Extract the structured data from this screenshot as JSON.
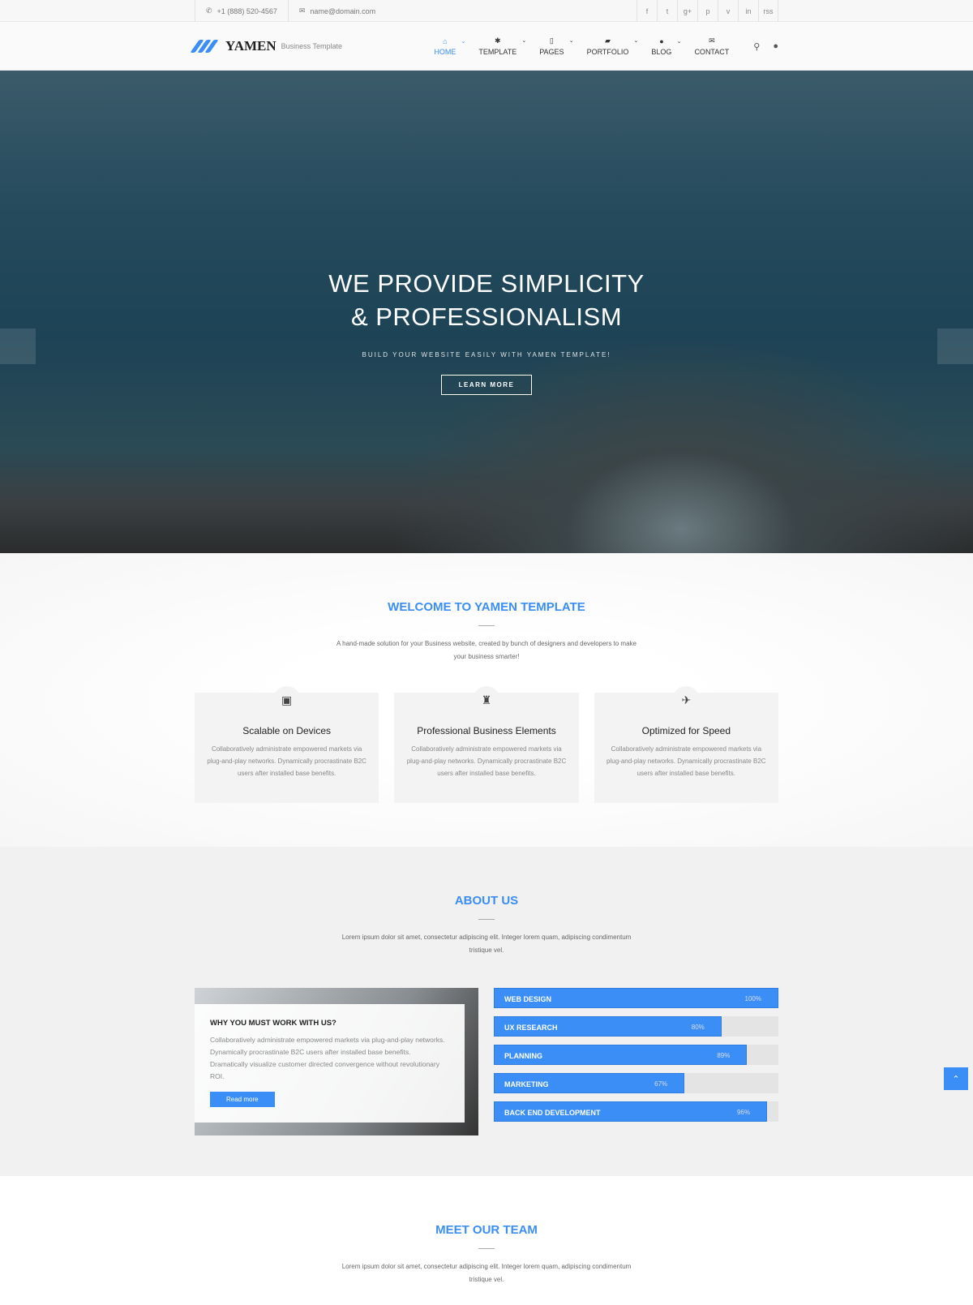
{
  "topbar": {
    "phone": "+1 (888) 520-4567",
    "email": "name@domain.com",
    "socials": [
      "f",
      "t",
      "g+",
      "p",
      "v",
      "in",
      "rss"
    ]
  },
  "brand": {
    "name": "YAMEN",
    "tagline": "Business Template",
    "accent": "#3a8ef5"
  },
  "nav": [
    {
      "label": "HOME",
      "icon": "⌂",
      "caret": true
    },
    {
      "label": "TEMPLATE",
      "icon": "✱",
      "caret": true
    },
    {
      "label": "PAGES",
      "icon": "▯",
      "caret": true
    },
    {
      "label": "PORTFOLIO",
      "icon": "▰",
      "caret": true
    },
    {
      "label": "BLOG",
      "icon": "●",
      "caret": true
    },
    {
      "label": "CONTACT",
      "icon": "✉",
      "caret": false
    }
  ],
  "hero": {
    "line1": "WE PROVIDE SIMPLICITY",
    "line2": "& PROFESSIONALISM",
    "subtitle": "BUILD YOUR WEBSITE EASILY WITH YAMEN TEMPLATE!",
    "button": "LEARN MORE"
  },
  "welcome": {
    "title": "WELCOME TO YAMEN TEMPLATE",
    "desc": "A hand-made solution for your Business website, created by bunch of designers and developers to make your business smarter!",
    "features": [
      {
        "icon": "▣",
        "title": "Scalable on Devices",
        "text": "Collaboratively administrate empowered markets via plug-and-play networks. Dynamically procrastinate B2C users after installed base benefits."
      },
      {
        "icon": "♜",
        "title": "Professional Business Elements",
        "text": "Collaboratively administrate empowered markets via plug-and-play networks. Dynamically procrastinate B2C users after installed base benefits."
      },
      {
        "icon": "✈",
        "title": "Optimized for Speed",
        "text": "Collaboratively administrate empowered markets via plug-and-play networks. Dynamically procrastinate B2C users after installed base benefits."
      }
    ]
  },
  "about": {
    "title": "ABOUT US",
    "desc": "Lorem ipsum dolor sit amet, consectetur adipiscing elit. Integer lorem quam, adipiscing condimentum tristique vel.",
    "card": {
      "title": "WHY YOU MUST WORK WITH US?",
      "text": "Collaboratively administrate empowered markets via plug-and-play networks. Dynamically procrastinate B2C users after installed base benefits. Dramatically visualize customer directed convergence without revolutionary ROI.",
      "button": "Read more"
    },
    "skills": [
      {
        "name": "WEB DESIGN",
        "value": 100,
        "label": "100%"
      },
      {
        "name": "UX RESEARCH",
        "value": 80,
        "label": "80%"
      },
      {
        "name": "PLANNING",
        "value": 89,
        "label": "89%"
      },
      {
        "name": "MARKETING",
        "value": 67,
        "label": "67%"
      },
      {
        "name": "BACK END DEVELOPMENT",
        "value": 96,
        "label": "96%"
      }
    ]
  },
  "team": {
    "title": "MEET OUR TEAM",
    "desc": "Lorem ipsum dolor sit amet, consectetur adipiscing elit. Integer lorem quam, adipiscing condimentum tristique vel."
  }
}
